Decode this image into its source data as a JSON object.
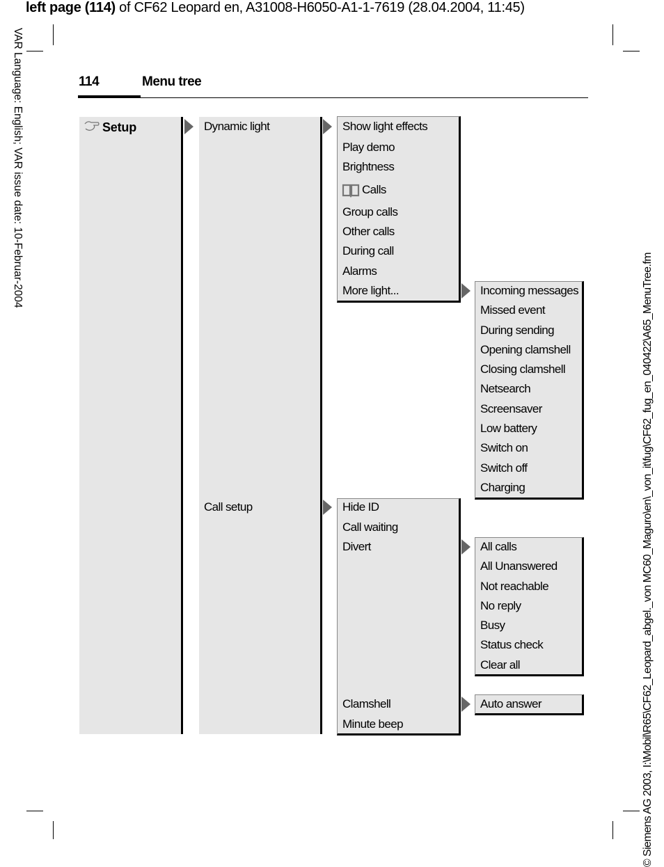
{
  "header": {
    "prefix": "left page (114)",
    "rest": " of CF62 Leopard en, A31008-H6050-A1-1-7619 (28.04.2004, 11:45)"
  },
  "left_margin": "VAR Language: English; VAR issue date: 10-Februar-2004",
  "right_margin": "© Siemens AG 2003, I:\\Mobil\\R65\\CF62_Leopard_abgel._von MC60_Maguro\\en\\_von_it\\fug\\CF62_fug_en_040422\\A65_MenuTree.fm",
  "page_number": "114",
  "page_title": "Menu tree",
  "tree": {
    "root": {
      "label": "Setup",
      "icon": "wrench-icon"
    },
    "level2": [
      "Dynamic light",
      "Call setup"
    ],
    "dynamic_light_items": [
      "Show light effects",
      "Play demo",
      "Brightness",
      "Calls",
      "Group calls",
      "Other calls",
      "During call",
      "Alarms",
      "More light..."
    ],
    "calls_icon": "phonebook-icon",
    "more_light_items": [
      "Incoming messages",
      "Missed event",
      "During sending",
      "Opening clamshell",
      "Closing clamshell",
      "Netsearch",
      "Screensaver",
      "Low battery",
      "Switch on",
      "Switch off",
      "Charging"
    ],
    "call_setup_items": [
      "Hide ID",
      "Call waiting",
      "Divert",
      "Clamshell",
      "Minute beep"
    ],
    "divert_items": [
      "All calls",
      "All Unanswered",
      "Not reachable",
      "No reply",
      "Busy",
      "Status check",
      "Clear all"
    ],
    "clamshell_items": [
      "Auto answer"
    ]
  }
}
